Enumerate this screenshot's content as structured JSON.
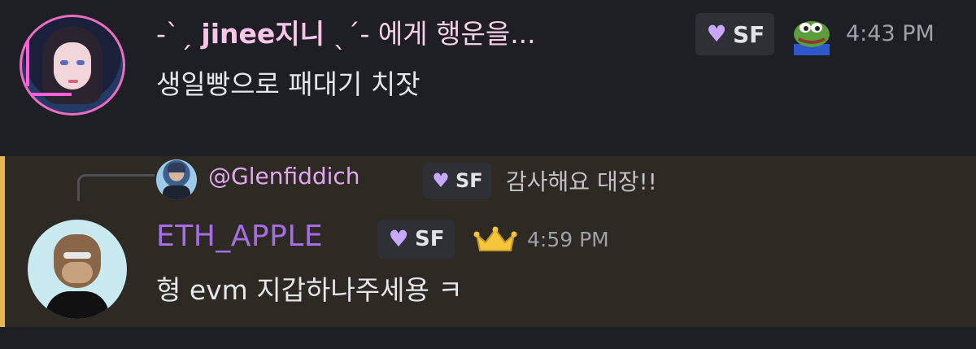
{
  "message1": {
    "author_prefix": "-ˋˏ ",
    "author_name": "jinee지니",
    "author_suffix": " ˎˊ- 에게 행운을...",
    "badge": "SF",
    "badge_icon": "heart-icon",
    "emote": "pepe-frog-icon",
    "time": "4:43 PM",
    "content": "생일빵으로 패대기 치잣"
  },
  "message2": {
    "reply": {
      "author": "@Glenfiddich",
      "badge": "SF",
      "content": "감사해요 대장!!"
    },
    "author_name": "ETH_APPLE",
    "badge": "SF",
    "role_icon": "crown-icon",
    "time": "4:59 PM",
    "content": "형 evm 지갑하나주세용 ㅋ"
  },
  "colors": {
    "background": "#1e1f24",
    "highlight": "#2c2a22",
    "highlight_bar": "#e8b54c",
    "username2": "#a66de6",
    "timestamp": "#9ea1a8"
  }
}
